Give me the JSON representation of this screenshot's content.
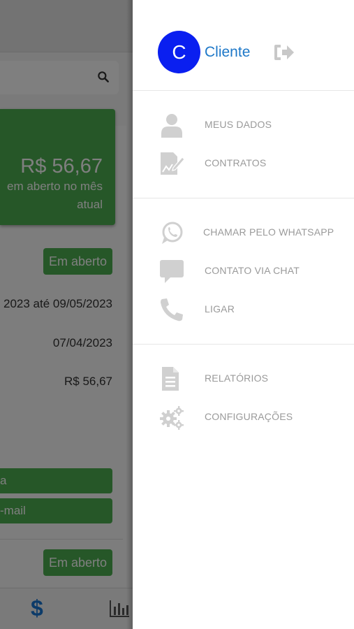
{
  "background_screen": {
    "summary": {
      "amount": "R$ 56,67",
      "subtitle": "em aberto no mês atual"
    },
    "invoice": {
      "status_badge": "Em aberto",
      "period": "2023 até 09/05/2023",
      "due_date": "07/04/2023",
      "value": "R$ 56,67"
    },
    "buttons": [
      {
        "label": "a"
      },
      {
        "label": "-mail"
      }
    ],
    "second_status_badge": "Em aberto",
    "accent_color": "#4caf50",
    "bottom_nav": {
      "dollar_icon": "$",
      "chart_icon": "bar-chart-icon"
    }
  },
  "drawer": {
    "avatar_letter": "C",
    "avatar_color": "#0a1ff0",
    "user_name": "Cliente",
    "logout_icon": "logout-icon",
    "sections": [
      {
        "items": [
          {
            "icon": "user-icon",
            "label": "MEUS DADOS"
          },
          {
            "icon": "contract-icon",
            "label": "CONTRATOS"
          }
        ]
      },
      {
        "items": [
          {
            "icon": "whatsapp-icon",
            "label": "CHAMAR PELO WHATSAPP"
          },
          {
            "icon": "chat-icon",
            "label": "CONTATO VIA CHAT"
          },
          {
            "icon": "phone-icon",
            "label": "LIGAR"
          }
        ]
      },
      {
        "items": [
          {
            "icon": "report-icon",
            "label": "RELATÓRIOS"
          },
          {
            "icon": "gears-icon",
            "label": "CONFIGURAÇÕES"
          }
        ]
      }
    ]
  }
}
